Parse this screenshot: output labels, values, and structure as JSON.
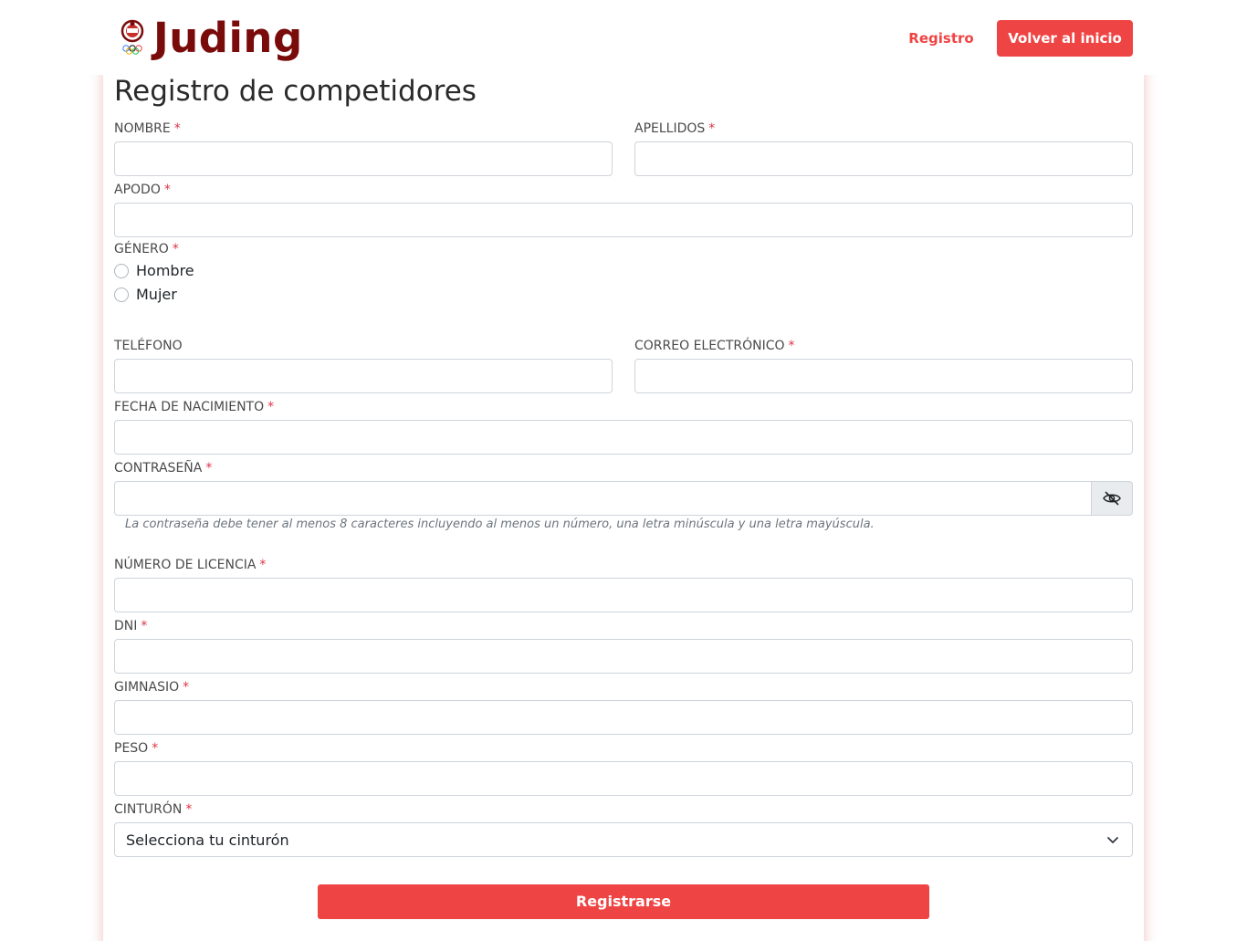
{
  "brand": {
    "name": "Juding"
  },
  "nav": {
    "register_link": "Registro",
    "home_button": "Volver al inicio"
  },
  "form": {
    "title": "Registro de competidores",
    "required_mark": "*",
    "fields": {
      "nombre": "NOMBRE",
      "apellidos": "APELLIDOS",
      "apodo": "APODO",
      "genero": "GÉNERO",
      "telefono": "TELÉFONO",
      "correo": "CORREO ELECTRÓNICO",
      "fecha": "FECHA DE NACIMIENTO",
      "contrasena": "CONTRASEÑA",
      "licencia": "NÚMERO DE LICENCIA",
      "dni": "DNI",
      "gimnasio": "GIMNASIO",
      "peso": "PESO",
      "cinturon": "CINTURÓN"
    },
    "gender_options": [
      "Hombre",
      "Mujer"
    ],
    "password_hint": "La contraseña debe tener al menos 8 caracteres incluyendo al menos un número, una letra minúscula y una letra mayúscula.",
    "belt_placeholder": "Selecciona tu cinturón",
    "submit_label": "Registrarse"
  },
  "colors": {
    "accent": "#ef4444",
    "brand": "#7a0b0b",
    "required": "#dc3545"
  },
  "icons": {
    "logo": "judo-crest-icon",
    "password_toggle": "eye-slash-icon",
    "select_arrow": "chevron-down-icon"
  }
}
